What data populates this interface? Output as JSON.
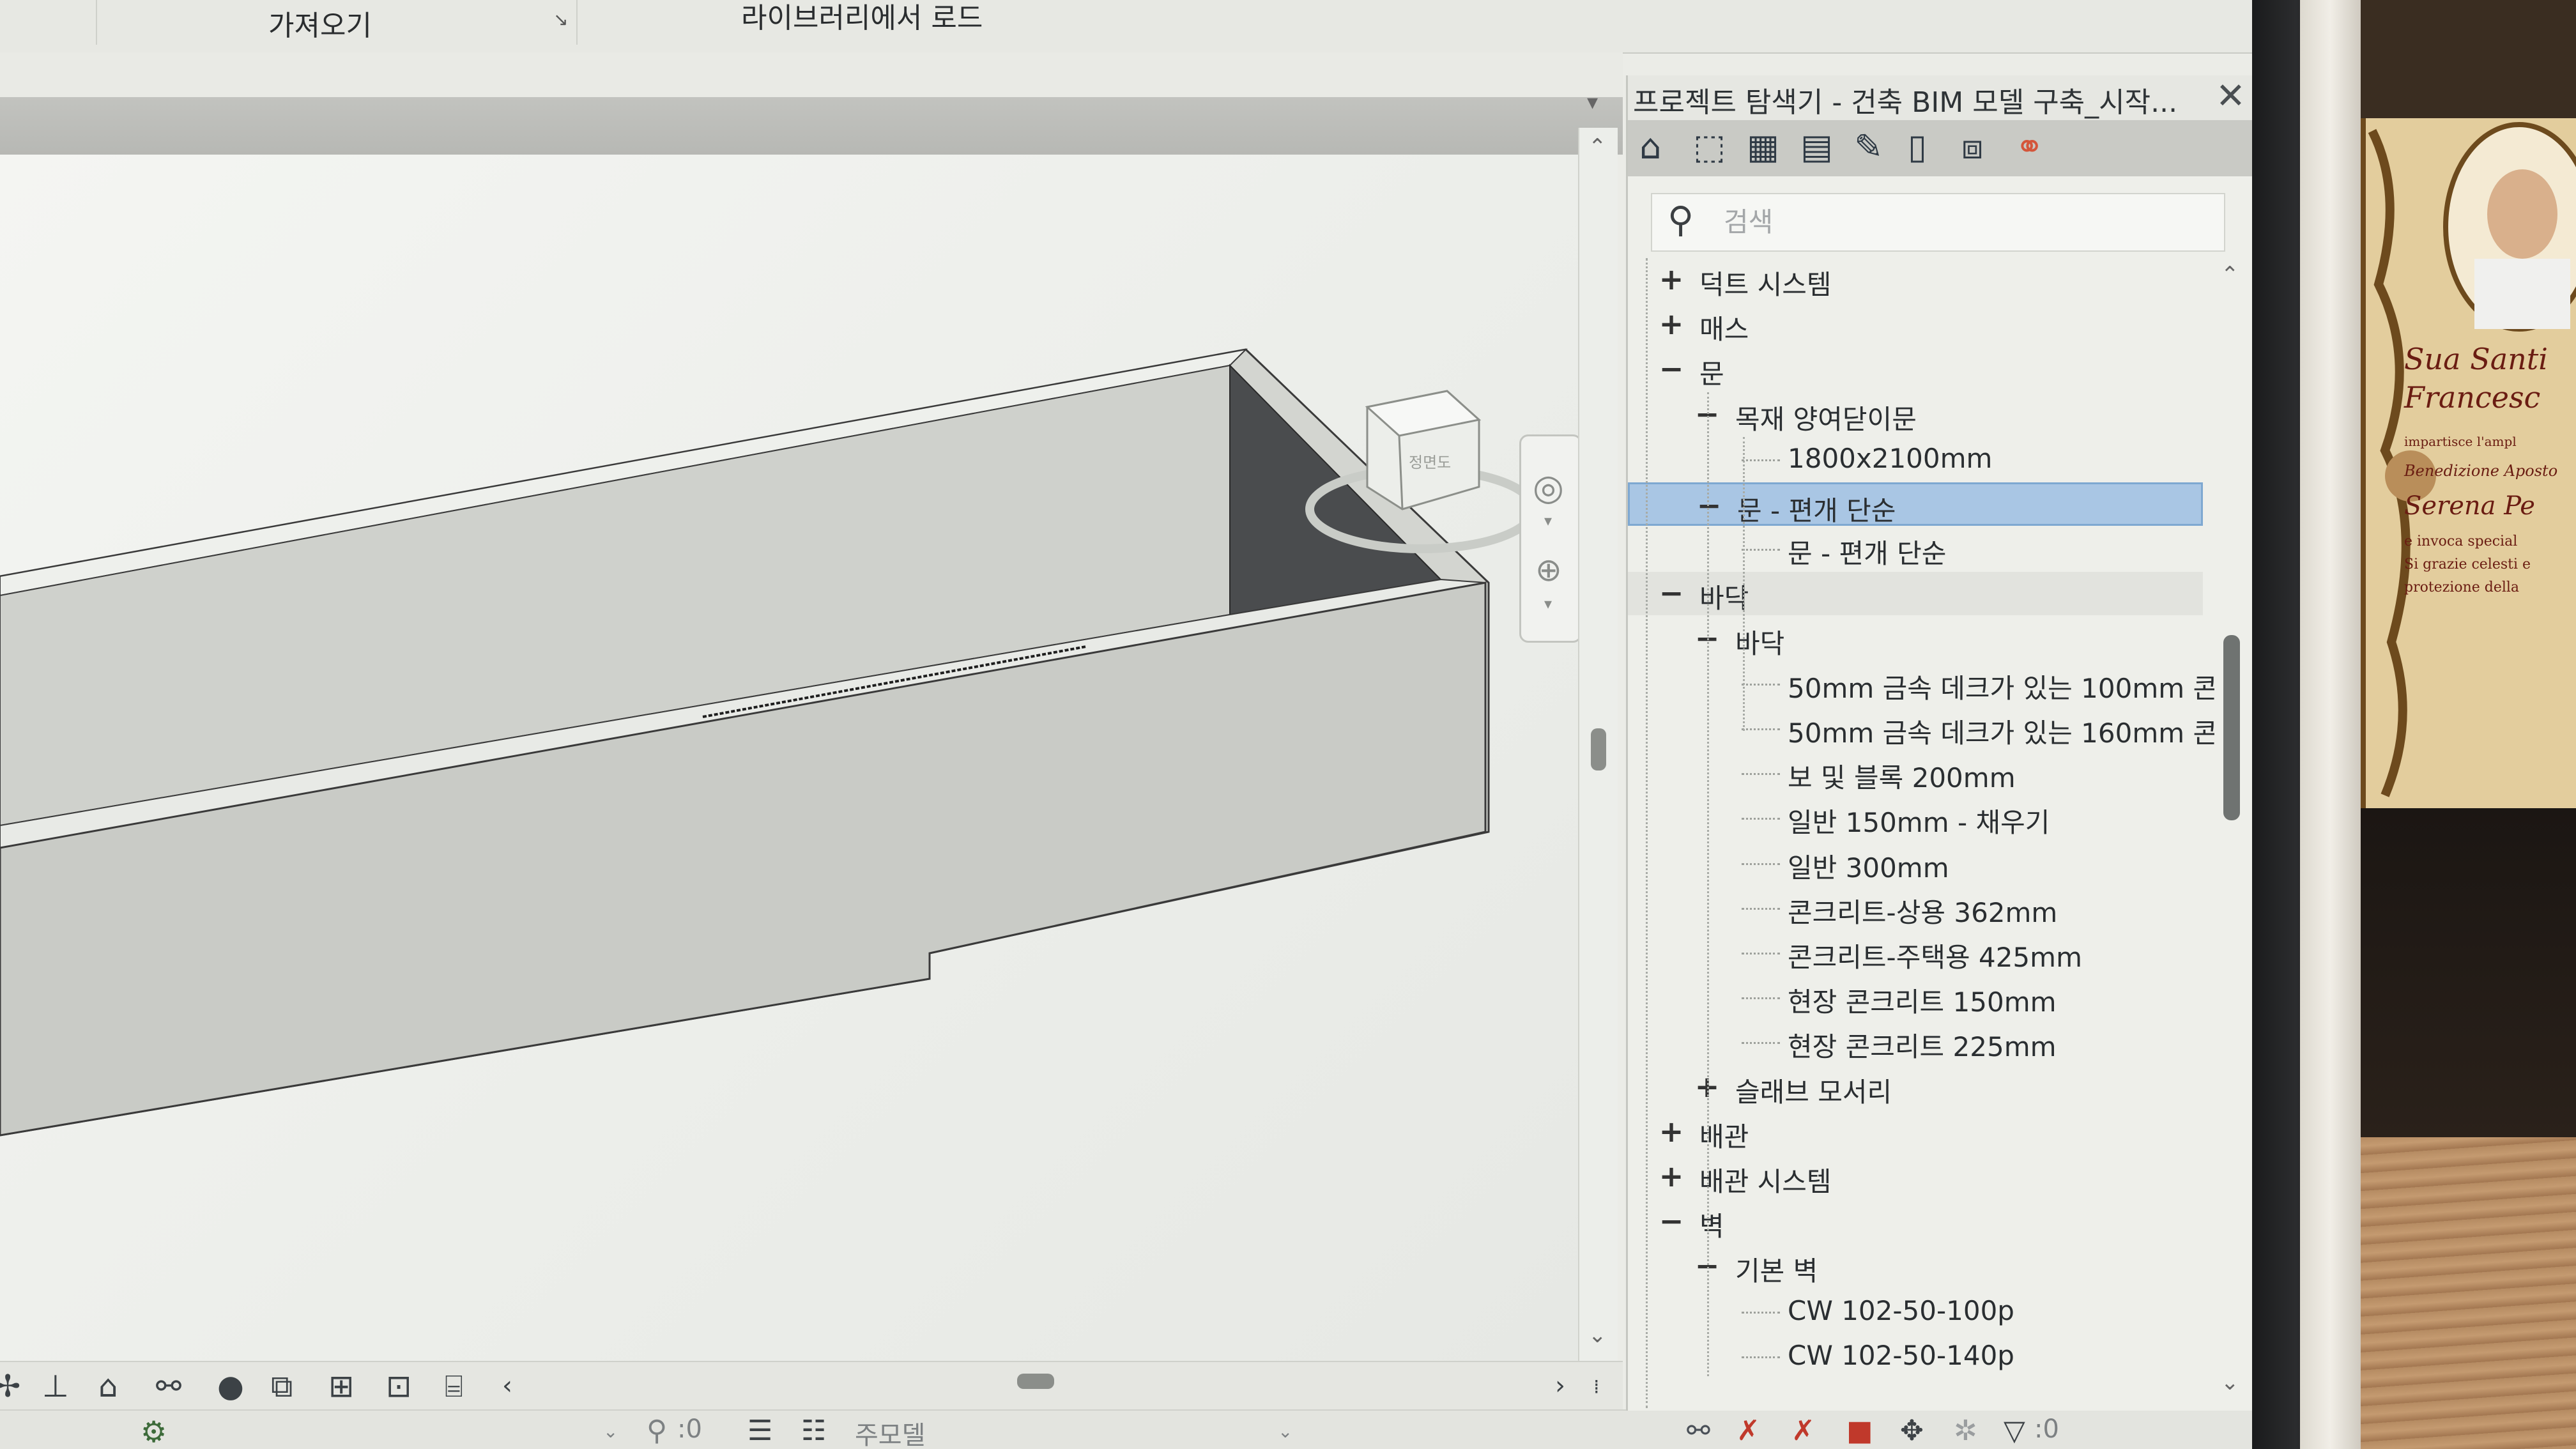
{
  "ribbon": {
    "import_label": "가져오기",
    "library_load_label": "라이브러리에서 로드"
  },
  "project_browser": {
    "title": "프로젝트 탐색기 - 건축 BIM 모델 구축_시작...",
    "close_symbol": "✕",
    "search_placeholder": "검색",
    "tree": [
      {
        "label": "덕트 시스템",
        "level": 0,
        "control": "+"
      },
      {
        "label": "매스",
        "level": 0,
        "control": "+"
      },
      {
        "label": "문",
        "level": 0,
        "control": "−"
      },
      {
        "label": "목재 양여닫이문",
        "level": 1,
        "control": "−"
      },
      {
        "label": "1800x2100mm",
        "level": 2,
        "control": ""
      },
      {
        "label": "문 - 편개 단순",
        "level": 1,
        "control": "−",
        "selected": true
      },
      {
        "label": "문 - 편개 단순",
        "level": 2,
        "control": ""
      },
      {
        "label": "바닥",
        "level": 0,
        "control": "−",
        "hover": true
      },
      {
        "label": "바닥",
        "level": 1,
        "control": "−"
      },
      {
        "label": "50mm 금속 데크가 있는 100mm 콘",
        "level": 2,
        "control": ""
      },
      {
        "label": "50mm 금속 데크가 있는 160mm 콘",
        "level": 2,
        "control": ""
      },
      {
        "label": "보 및 블록 200mm",
        "level": 2,
        "control": ""
      },
      {
        "label": "일반 150mm - 채우기",
        "level": 2,
        "control": ""
      },
      {
        "label": "일반 300mm",
        "level": 2,
        "control": ""
      },
      {
        "label": "콘크리트-상용 362mm",
        "level": 2,
        "control": ""
      },
      {
        "label": "콘크리트-주택용 425mm",
        "level": 2,
        "control": ""
      },
      {
        "label": "현장 콘크리트 150mm",
        "level": 2,
        "control": ""
      },
      {
        "label": "현장 콘크리트 225mm",
        "level": 2,
        "control": ""
      },
      {
        "label": "슬래브 모서리",
        "level": 1,
        "control": "+"
      },
      {
        "label": "배관",
        "level": 0,
        "control": "+"
      },
      {
        "label": "배관 시스템",
        "level": 0,
        "control": "+"
      },
      {
        "label": "벽",
        "level": 0,
        "control": "−"
      },
      {
        "label": "기본 벽",
        "level": 1,
        "control": "−"
      },
      {
        "label": "CW 102-50-100p",
        "level": 2,
        "control": ""
      },
      {
        "label": "CW 102-50-140p",
        "level": 2,
        "control": ""
      }
    ]
  },
  "statusbar": {
    "selection_count": ":0",
    "main_model_label": "주모델",
    "filter_count": ":0"
  },
  "viewcube": {
    "face_label": "정면도"
  },
  "photo_card": {
    "line1": "Sua Santi",
    "line2": "Francesc",
    "line3": "impartisce l'ampl",
    "line4": "Benedizione Aposto",
    "line5": "Serena Pe",
    "line6": "e invoca special",
    "line7": "Si grazie celesti e",
    "line8": "protezione della"
  },
  "colors": {
    "selection": "#a9c6e4",
    "selection_border": "#7ea8d1",
    "link_icon": "#d4553a"
  }
}
